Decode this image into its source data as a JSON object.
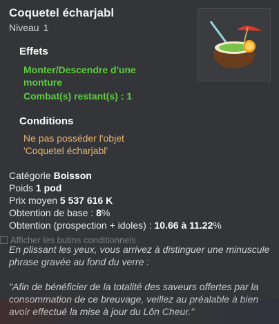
{
  "tooltip": {
    "title": "Coquetel écharjabl",
    "level_label": "Niveau",
    "level_value": "1",
    "effects_title": "Effets",
    "effects": [
      "Monter/Descendre d'une monture",
      "Combat(s) restant(s) : 1"
    ],
    "conditions_title": "Conditions",
    "conditions": [
      "Ne pas posséder l'objet 'Coquetel écharjabl'"
    ],
    "stats": {
      "category_label": "Catégorie",
      "category_value": "Boisson",
      "weight_label": "Poids",
      "weight_value": "1 pod",
      "avg_price_label": "Prix moyen",
      "avg_price_value": "5 537 616 K",
      "base_drop_label": "Obtention de base :",
      "base_drop_value": "8",
      "base_drop_unit": "%",
      "prospect_label": "Obtention (prospection + idoles) :",
      "prospect_value": "10.66 à 11.22",
      "prospect_unit": "%"
    },
    "show_loot_label": "Afficher les butins conditionnels",
    "description_1": "En plissant les yeux, vous arrivez à distinguer une minuscule phrase gravée au fond du verre :",
    "description_2": "\"Afin de bénéficier de la totalité des saveurs offertes par la consommation de ce breuvage, veillez au préalable à bien avoir effectué la mise à jour du Lôn Cheur.\"",
    "item_icon": "coconut-cocktail-icon"
  }
}
